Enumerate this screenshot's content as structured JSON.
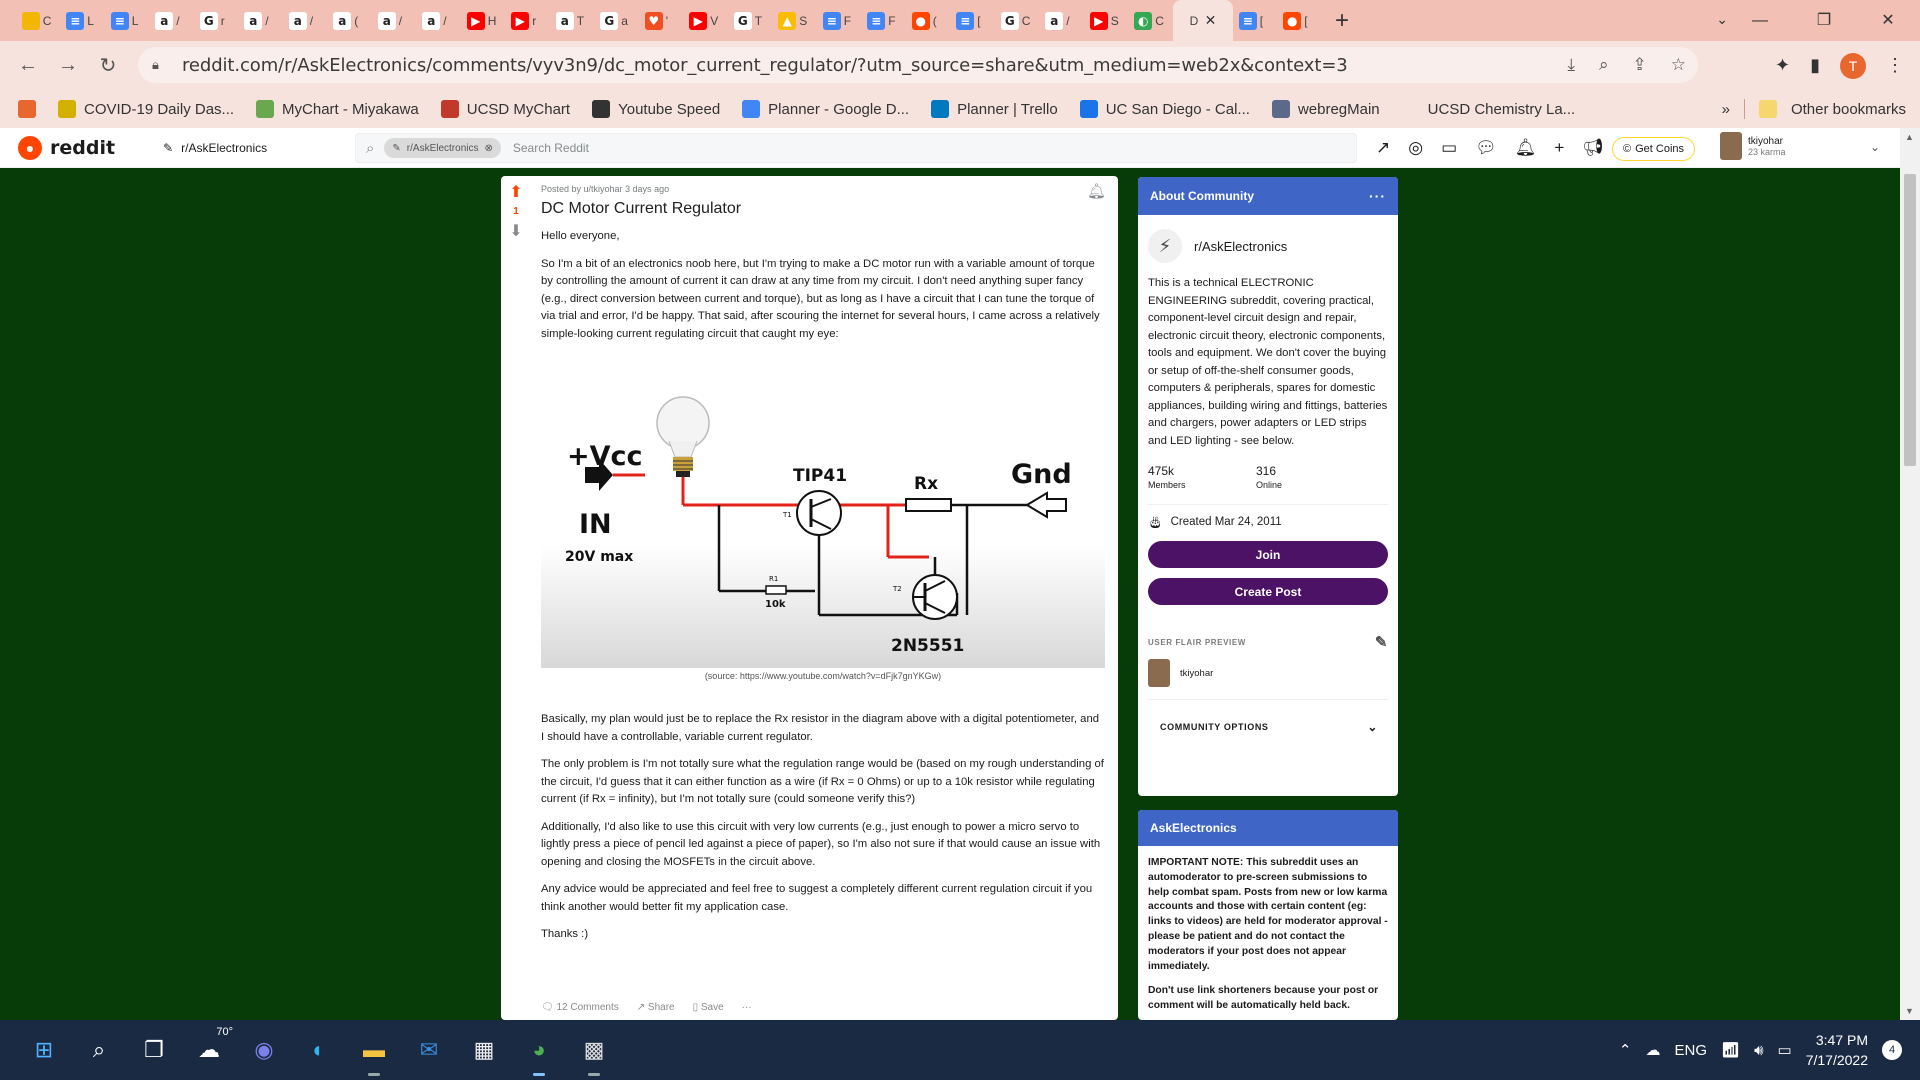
{
  "browser": {
    "tabs": [
      {
        "icon": "yellow-circle-icon",
        "color": "#f2b705",
        "label": "C",
        "glyph": ""
      },
      {
        "icon": "docs-icon",
        "color": "#4285f4",
        "label": "L",
        "glyph": "≡"
      },
      {
        "icon": "docs-icon",
        "color": "#4285f4",
        "label": "L",
        "glyph": "≡"
      },
      {
        "icon": "amazon-icon",
        "color": "#ffffff",
        "label": "/",
        "glyph": "a"
      },
      {
        "icon": "google-icon",
        "color": "#ffffff",
        "label": "r",
        "glyph": "G"
      },
      {
        "icon": "amazon-icon",
        "color": "#ffffff",
        "label": "/",
        "glyph": "a"
      },
      {
        "icon": "amazon-icon",
        "color": "#ffffff",
        "label": "/",
        "glyph": "a"
      },
      {
        "icon": "amazon-icon",
        "color": "#ffffff",
        "label": "(",
        "glyph": "a"
      },
      {
        "icon": "amazon-icon",
        "color": "#ffffff",
        "label": "/",
        "glyph": "a"
      },
      {
        "icon": "amazon-icon",
        "color": "#ffffff",
        "label": "/",
        "glyph": "a"
      },
      {
        "icon": "youtube-icon",
        "color": "#ff0000",
        "label": "H",
        "glyph": "▶"
      },
      {
        "icon": "youtube-icon",
        "color": "#ff0000",
        "label": "r",
        "glyph": "▶"
      },
      {
        "icon": "amazon-icon",
        "color": "#ffffff",
        "label": "T",
        "glyph": "a"
      },
      {
        "icon": "google-icon",
        "color": "#ffffff",
        "label": "a",
        "glyph": "G"
      },
      {
        "icon": "shield-icon",
        "color": "#f04e23",
        "label": "'",
        "glyph": "♥"
      },
      {
        "icon": "youtube-icon",
        "color": "#ff0000",
        "label": "V",
        "glyph": "▶"
      },
      {
        "icon": "google-icon",
        "color": "#ffffff",
        "label": "T",
        "glyph": "G"
      },
      {
        "icon": "drive-icon",
        "color": "#fbbc04",
        "label": "S",
        "glyph": "▲"
      },
      {
        "icon": "docs-icon",
        "color": "#4285f4",
        "label": "F",
        "glyph": "≡"
      },
      {
        "icon": "docs-icon",
        "color": "#4285f4",
        "label": "F",
        "glyph": "≡"
      },
      {
        "icon": "reddit-icon",
        "color": "#ff4500",
        "label": "(",
        "glyph": "●"
      },
      {
        "icon": "docs-icon",
        "color": "#4285f4",
        "label": "[",
        "glyph": "≡"
      },
      {
        "icon": "google-icon",
        "color": "#ffffff",
        "label": "C",
        "glyph": "G"
      },
      {
        "icon": "amazon-icon",
        "color": "#ffffff",
        "label": "/",
        "glyph": "a"
      },
      {
        "icon": "youtube-icon",
        "color": "#ff0000",
        "label": "S",
        "glyph": "▶"
      },
      {
        "icon": "chrome-icon",
        "color": "#34a853",
        "label": "C",
        "glyph": "◐"
      }
    ],
    "active_tab": {
      "label": "D",
      "close": "✕"
    },
    "tabs_after": [
      {
        "icon": "docs-icon",
        "color": "#4285f4",
        "label": "[",
        "glyph": "≡"
      },
      {
        "icon": "reddit-icon",
        "color": "#ff4500",
        "label": "[",
        "glyph": "●"
      }
    ],
    "new_tab": "+",
    "url": "reddit.com/r/AskElectronics/comments/vyv3n9/dc_motor_current_regulator/?utm_source=share&utm_medium=web2x&context=3",
    "profile_letter": "T",
    "bookmarks": [
      {
        "label": "",
        "color": "#e8672e"
      },
      {
        "label": "COVID-19 Daily Das...",
        "color": "#d4b000"
      },
      {
        "label": "MyChart - Miyakawa",
        "color": "#6aa84f"
      },
      {
        "label": "UCSD MyChart",
        "color": "#c0392b"
      },
      {
        "label": "Youtube Speed",
        "color": "#333333"
      },
      {
        "label": "Planner - Google D...",
        "color": "#4285f4"
      },
      {
        "label": "Planner | Trello",
        "color": "#0079bf"
      },
      {
        "label": "UC San Diego - Cal...",
        "color": "#1a73e8"
      },
      {
        "label": "webregMain",
        "color": "#5b6a8a"
      },
      {
        "label": "UCSD Chemistry La...",
        "color": "transparent"
      }
    ],
    "bookmarks_more": "»",
    "other_bookmarks": "Other bookmarks"
  },
  "reddit": {
    "logo_text": "reddit",
    "community_selector": "r/AskElectronics",
    "search_pill": "r/AskElectronics",
    "search_placeholder": "Search Reddit",
    "get_coins": "Get Coins",
    "username": "tkiyohar",
    "karma": "23 karma"
  },
  "post": {
    "votes": "1",
    "meta": "Posted by u/tkiyohar 3 days ago",
    "title": "DC Motor Current Regulator",
    "greeting": "Hello everyone,",
    "p1": "So I'm a bit of an electronics noob here, but I'm trying to make a DC motor run with a variable amount of torque by controlling the amount of current it can draw at any time from my circuit. I don't need anything super fancy (e.g., direct conversion between current and torque), but as long as I have a circuit that I can tune the torque of via trial and error, I'd be happy. That said, after scouring the internet for several hours, I came across a relatively simple-looking current regulating circuit that caught my eye:",
    "figure": {
      "vcc": "+Vcc",
      "in": "IN",
      "max": "20V max",
      "t1": "TIP41",
      "t1_label": "T1",
      "rx": "Rx",
      "gnd": "Gnd",
      "r1": "R1",
      "r1_val": "10k",
      "t2_label": "T2",
      "t2": "2N5551"
    },
    "caption": "(source: https://www.youtube.com/watch?v=dFjk7gnYKGw)",
    "p2": "Basically, my plan would just be to replace the Rx resistor in the diagram above with a digital potentiometer, and I should have a controllable, variable current regulator.",
    "p3": "The only problem is I'm not totally sure what the regulation range would be (based on my rough understanding of the circuit, I'd guess that it can either function as a wire (if Rx = 0 Ohms) or up to a 10k resistor while regulating current (if Rx = infinity), but I'm not totally sure (could someone verify this?)",
    "p4": "Additionally, I'd also like to use this circuit with very low currents (e.g., just enough to power a micro servo to lightly press a piece of pencil led against a piece of paper), so I'm also not sure if that would cause an issue with opening and closing the MOSFETs in the circuit above.",
    "p5": "Any advice would be appreciated and feel free to suggest a completely different current regulation circuit if you think another would better fit my application case.",
    "p6": "Thanks :)",
    "comments": "12 Comments",
    "share": "Share",
    "save": "Save",
    "more": "···"
  },
  "about": {
    "header": "About Community",
    "dots": "···",
    "name": "r/AskElectronics",
    "description": "This is a technical ELECTRONIC ENGINEERING subreddit, covering practical, component-level circuit design and repair, electronic circuit theory, electronic components, tools and equipment. We don't cover the buying or setup of off-the-shelf consumer goods, computers & peripherals, spares for domestic appliances, building wiring and fittings, batteries and chargers, power adapters or LED strips and LED lighting - see below.",
    "members_count": "475k",
    "members_label": "Members",
    "online_count": "316",
    "online_label": "Online",
    "created": "Created Mar 24, 2011",
    "join": "Join",
    "create_post": "Create Post",
    "flair_label": "USER FLAIR PREVIEW",
    "flair_user": "tkiyohar",
    "community_options": "COMMUNITY OPTIONS"
  },
  "rules": {
    "header": "AskElectronics",
    "note1": "IMPORTANT NOTE: This subreddit uses an automoderator to pre-screen submissions to help combat spam. Posts from new or low karma accounts and those with certain content (eg: links to videos) are held for moderator approval - please be patient and do not contact the moderators if your post does not appear immediately.",
    "note2": "Don't use link shorteners because your post or comment will be automatically held back."
  },
  "taskbar": {
    "weather_temp": "70°",
    "lang": "ENG",
    "time": "3:47 PM",
    "date": "7/17/2022",
    "notifications": "4"
  }
}
